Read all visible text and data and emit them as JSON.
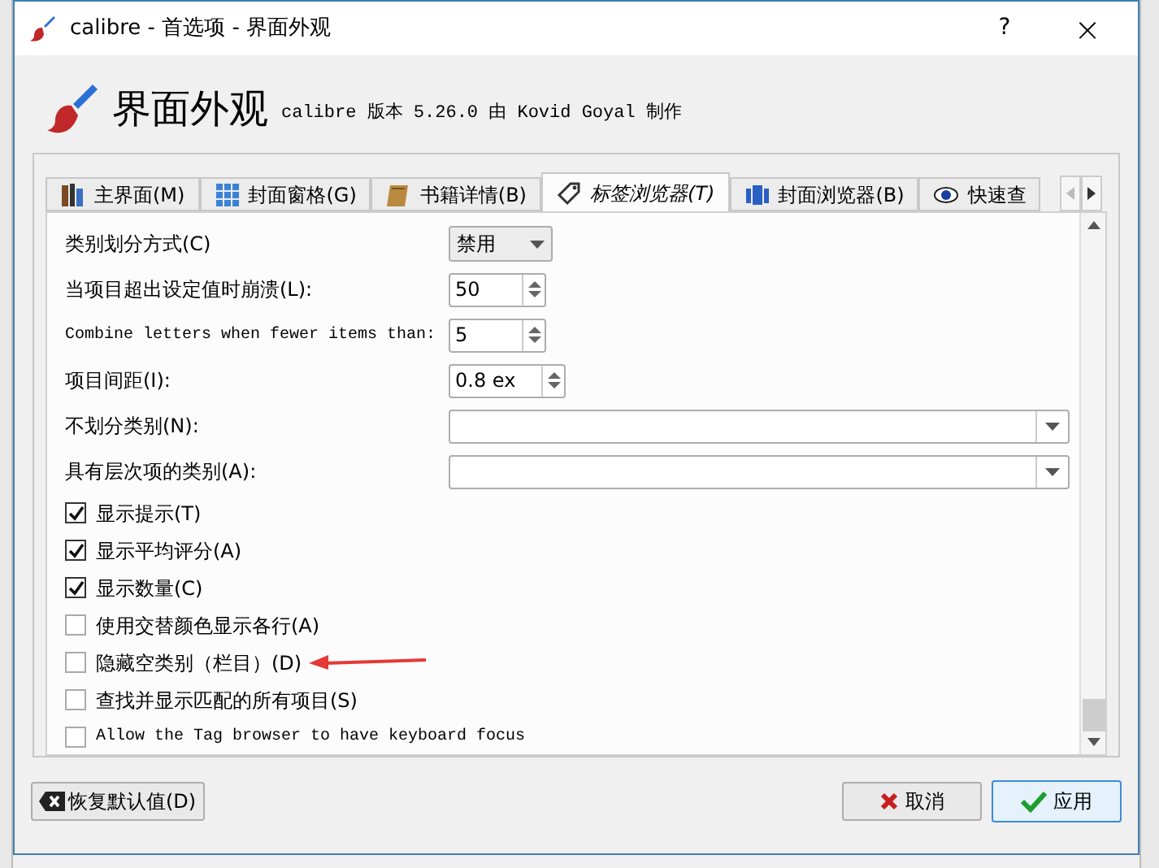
{
  "window": {
    "title": "calibre - 首选项 - 界面外观",
    "help_button": "?",
    "close_button": "×"
  },
  "header": {
    "title": "界面外观",
    "subtitle": "calibre 版本 5.26.0 由 Kovid Goyal 制作"
  },
  "tabs": [
    {
      "label": "主界面(M)",
      "selected": false
    },
    {
      "label": "封面窗格(G)",
      "selected": false
    },
    {
      "label": "书籍详情(B)",
      "selected": false
    },
    {
      "label": "标签浏览器(T)",
      "selected": true
    },
    {
      "label": "封面浏览器(B)",
      "selected": false
    },
    {
      "label": "快速查",
      "selected": false
    }
  ],
  "settings": [
    {
      "kind": "dropdown",
      "label": "类别划分方式(C)",
      "value": "禁用"
    },
    {
      "kind": "spin",
      "label": "当项目超出设定值时崩溃(L):",
      "value": "50"
    },
    {
      "kind": "spin",
      "label": "Combine letters when fewer items than:",
      "value": "5"
    },
    {
      "kind": "spin",
      "label": "项目间距(I):",
      "value": "0.8 ex"
    },
    {
      "kind": "combo",
      "label": "不划分类别(N):"
    },
    {
      "kind": "combo",
      "label": "具有层次项的类别(A):"
    },
    {
      "kind": "checkbox",
      "label": "显示提示(T)",
      "checked": true
    },
    {
      "kind": "checkbox",
      "label": "显示平均评分(A)",
      "checked": true
    },
    {
      "kind": "checkbox",
      "label": "显示数量(C)",
      "checked": true
    },
    {
      "kind": "checkbox",
      "label": "使用交替颜色显示各行(A)",
      "checked": false
    },
    {
      "kind": "checkbox",
      "label": "隐藏空类别（栏目）(D)",
      "checked": false
    },
    {
      "kind": "checkbox",
      "label": "查找并显示匹配的所有项目(S)",
      "checked": false
    },
    {
      "kind": "checkbox",
      "label": "Allow the Tag browser to have keyboard focus",
      "checked": false
    }
  ],
  "buttons": {
    "restore": "恢复默认值(D)",
    "cancel": "取消",
    "apply": "应用"
  }
}
